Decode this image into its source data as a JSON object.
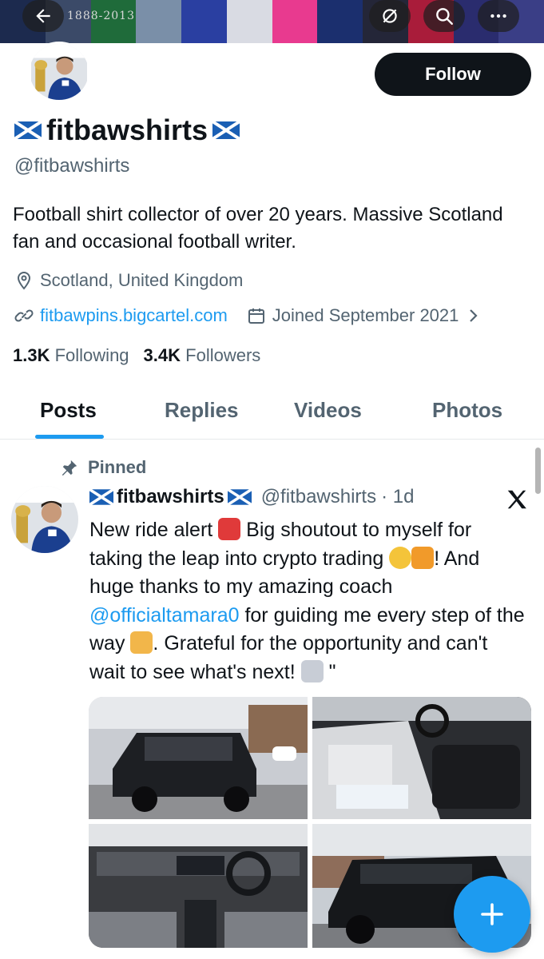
{
  "banner": {
    "overlay_text": "1888-2013",
    "colors": [
      "#1c2a4e",
      "#3b4a68",
      "#1f6b3a",
      "#7a8fa8",
      "#2a3fa1",
      "#d9dbe3",
      "#e83a8f",
      "#1b2f6e",
      "#242638",
      "#a91c3a",
      "#2a2c6e",
      "#3a3e86"
    ]
  },
  "profile": {
    "name": "fitbawshirts",
    "handle": "@fitbawshirts",
    "follow_label": "Follow",
    "bio": "Football shirt collector of over 20 years. Massive Scotland fan and occasional football writer.",
    "location": "Scotland, United Kingdom",
    "website": "fitbawpins.bigcartel.com",
    "joined": "Joined September 2021",
    "following_count": "1.3K",
    "following_label": "Following",
    "followers_count": "3.4K",
    "followers_label": "Followers"
  },
  "tabs": [
    {
      "label": "Posts",
      "active": true
    },
    {
      "label": "Replies",
      "active": false
    },
    {
      "label": "Videos",
      "active": false
    },
    {
      "label": "Photos",
      "active": false
    }
  ],
  "post": {
    "pinned_label": "Pinned",
    "author": "fitbawshirts",
    "handle": "@fitbawshirts",
    "time": "· 1d",
    "text_1": "New ride alert",
    "text_2": "Big shoutout to myself for taking the leap into crypto trading",
    "text_3": "! And huge thanks to my amazing coach",
    "mention": "@officialtamara0",
    "text_4": "for guiding me every step of the way",
    "text_5": ". Grateful for the opportunity and can't wait to see what's next!",
    "text_6": "\""
  },
  "icons": {
    "back": "arrow-left-icon",
    "mute": "bell-off-icon",
    "search": "search-icon",
    "more": "more-icon",
    "location": "map-pin-icon",
    "link": "link-icon",
    "calendar": "calendar-icon",
    "chevron": "chevron-right-icon",
    "pin": "pin-icon",
    "x_logo": "x-logo-icon",
    "compose": "plus-icon"
  },
  "colors": {
    "accent": "#1d9bf0",
    "text": "#0f1419",
    "secondary": "#536471"
  }
}
